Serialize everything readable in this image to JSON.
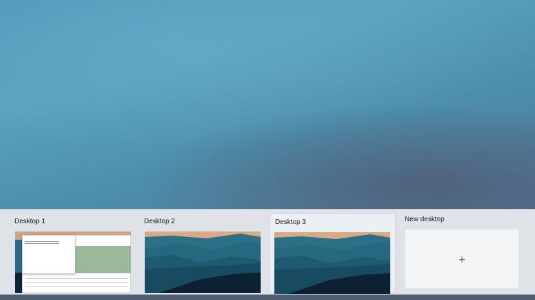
{
  "desktops": [
    {
      "label": "Desktop 1"
    },
    {
      "label": "Desktop 2"
    },
    {
      "label": "Desktop 3",
      "active": true
    }
  ],
  "new_desktop": {
    "label": "New desktop",
    "icon": "plus-icon",
    "symbol": "+"
  },
  "colors": {
    "indicator": "#1f6fd0",
    "panel": "#dfe3e8"
  }
}
